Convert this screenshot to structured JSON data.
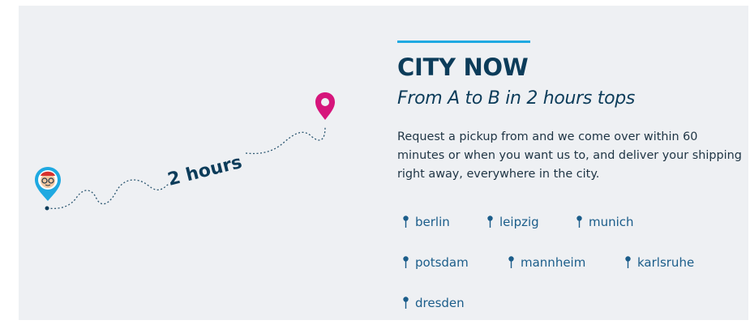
{
  "section": {
    "title": "CITY NOW",
    "subtitle": "From A to B in 2 hours tops",
    "description": "Request a pickup from and we come over within 60 minutes or when you want us to, and deliver your shipping right away, everywhere in the city."
  },
  "illustration": {
    "route_label": "2 hours",
    "start_icon": "courier-avatar-pin-icon",
    "end_icon": "destination-pin-icon"
  },
  "cities": [
    {
      "label": "berlin"
    },
    {
      "label": "leipzig"
    },
    {
      "label": "munich"
    },
    {
      "label": "potsdam"
    },
    {
      "label": "mannheim"
    },
    {
      "label": "karlsruhe"
    },
    {
      "label": "dresden"
    }
  ],
  "colors": {
    "accent": "#1fa9e1",
    "heading": "#0c3c5a",
    "link": "#1b5d8a",
    "destination_pin": "#d6157b",
    "panel_background": "#eef0f3"
  }
}
